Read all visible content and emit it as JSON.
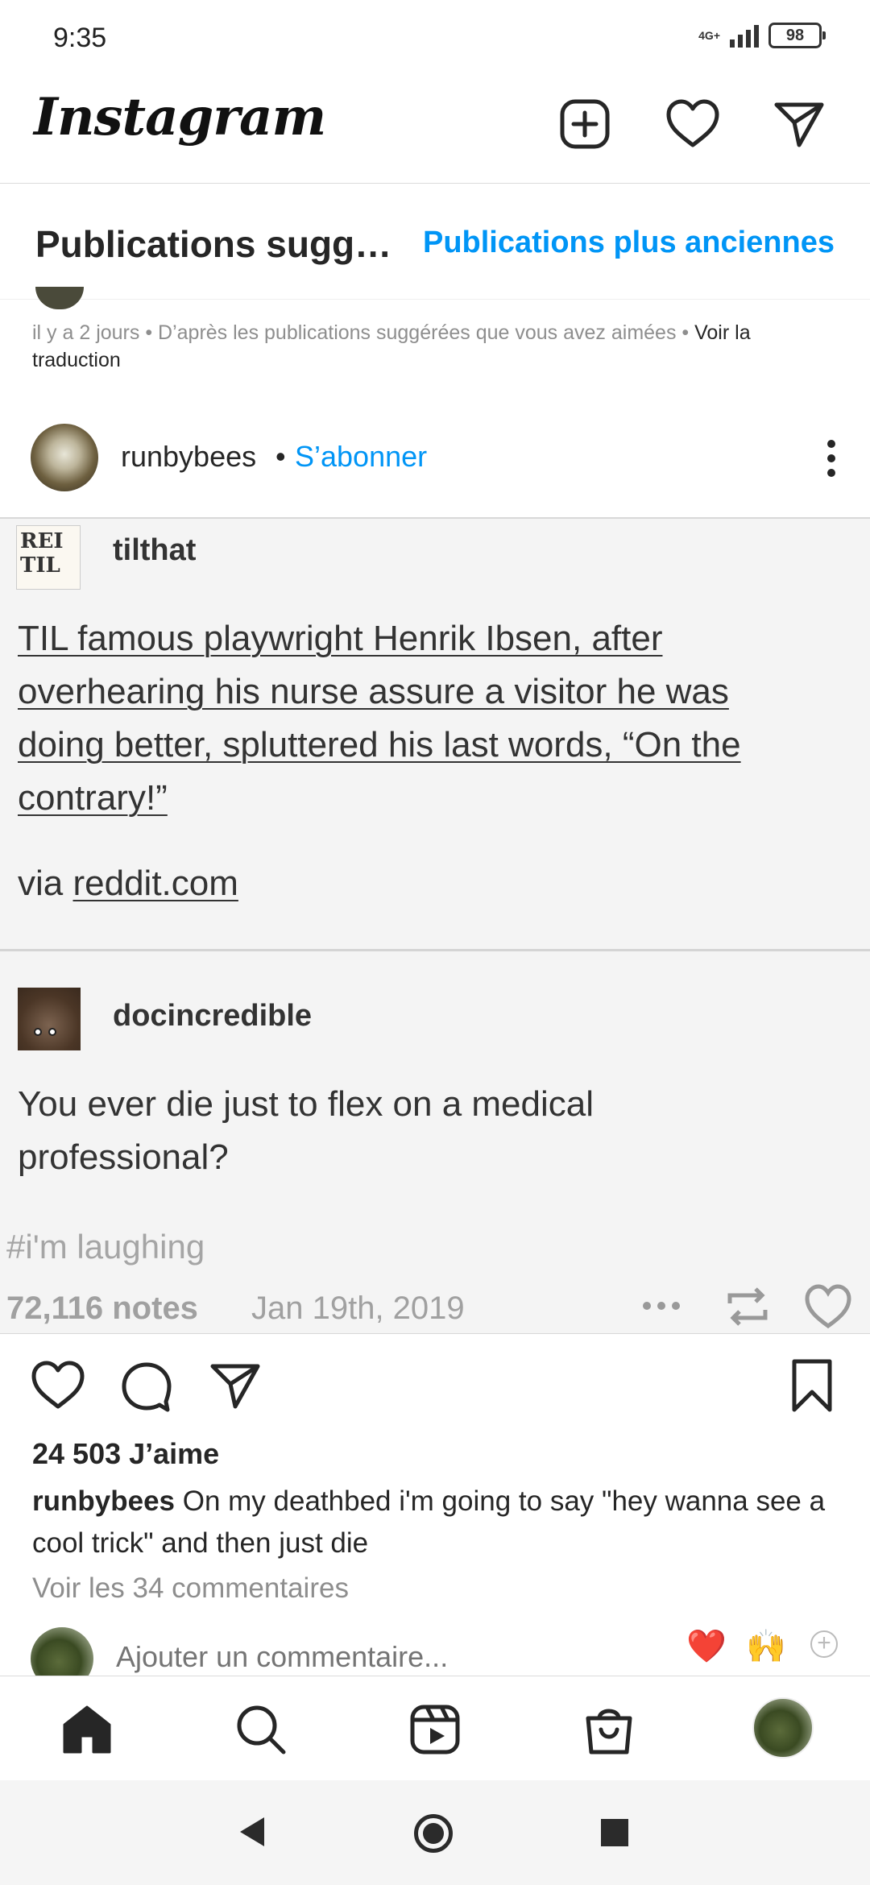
{
  "status": {
    "time": "9:35",
    "network": "4G+",
    "battery": "98"
  },
  "header": {
    "logo": "Instagram"
  },
  "feed": {
    "title": "Publications sugg…",
    "older_link": "Publications plus anciennes"
  },
  "previous_post": {
    "meta": "il y a 2 jours • D’après les publications suggérées que vous avez aimées • ",
    "translate": "Voir la traduction"
  },
  "post": {
    "username": "runbybees",
    "separator": "•",
    "follow": "S’abonner",
    "image": {
      "op_name": "tilthat",
      "op_avatar_text": "REI TIL",
      "op_text_lines": [
        "TIL famous playwright Henrik Ibsen, after",
        "overhearing his nurse assure a visitor he was",
        "doing better, spluttered his last words, “On the",
        "contrary!”"
      ],
      "via_prefix": "via ",
      "via_link": "reddit.com",
      "reply_name": "docincredible",
      "reply_text_lines": [
        "You ever die just to flex on a medical",
        "professional?"
      ],
      "tag": "#i'm laughing",
      "notes": "72,116 notes",
      "date": "Jan 19th, 2019"
    },
    "likes": "24 503 J’aime",
    "caption_user": "runbybees",
    "caption_text": " On my deathbed i'm going to say \"hey wanna see a cool trick\" and then just die",
    "view_comments": "Voir les 34 commentaires",
    "comment_placeholder": "Ajouter un commentaire...",
    "reactions": [
      "❤️",
      "🙌"
    ],
    "reaction_add": "+"
  },
  "colors": {
    "link": "#0095f6",
    "muted": "#8e8e8e",
    "text": "#262626"
  }
}
